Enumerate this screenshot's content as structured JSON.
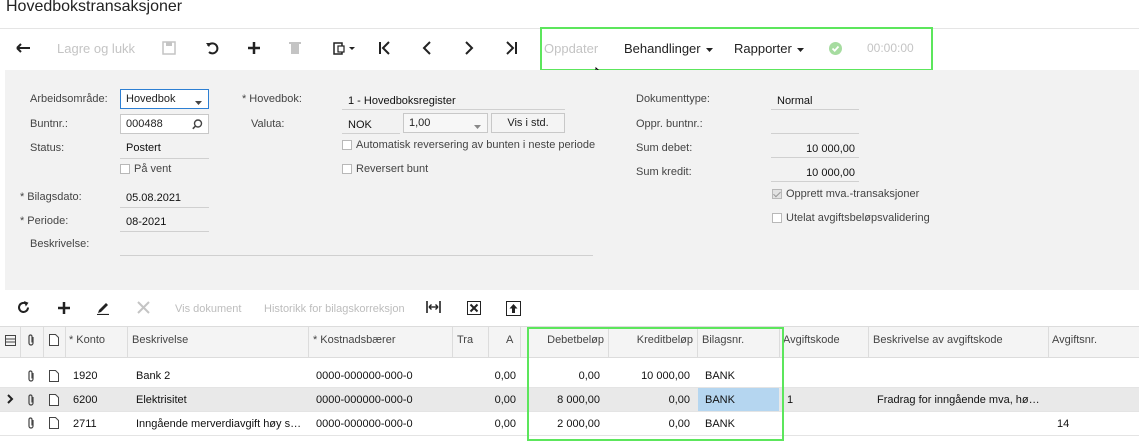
{
  "page": {
    "title": "Hovedbokstransaksjoner"
  },
  "toolbar": {
    "save_close": "Lagre og lukk",
    "update": "Oppdater",
    "actions": "Behandlinger",
    "reports": "Rapporter",
    "timer": "00:00:00",
    "icons": [
      "back-arrow-icon",
      "save-icon",
      "undo-icon",
      "add-icon",
      "delete-icon",
      "copy-paste-icon",
      "first-record-icon",
      "previous-record-icon",
      "next-record-icon",
      "last-record-icon",
      "checkmark-icon",
      "chevron-down-icon"
    ]
  },
  "form": {
    "arbeidsomrade_label": "Arbeidsområde:",
    "arbeidsomrade_value": "Hovedbok",
    "buntnr_label": "Buntnr.:",
    "buntnr_value": "000488",
    "status_label": "Status:",
    "status_value": "Postert",
    "pavent_label": "På vent",
    "bilagsdato_label": "Bilagsdato:",
    "bilagsdato_value": "05.08.2021",
    "periode_label": "Periode:",
    "periode_value": "08-2021",
    "beskrivelse_label": "Beskrivelse:",
    "hovedbok_label": "Hovedbok:",
    "hovedbok_value": "1 - Hovedboksregister",
    "valuta_label": "Valuta:",
    "valuta_value": "NOK",
    "valuta_rate": "1,00",
    "vis_std_label": "Vis i std.",
    "auto_rev_label": "Automatisk reversering av bunten i neste periode",
    "reversert_label": "Reversert bunt",
    "dokumenttype_label": "Dokumenttype:",
    "dokumenttype_value": "Normal",
    "oppr_buntnr_label": "Oppr. buntnr.:",
    "sum_debet_label": "Sum debet:",
    "sum_debet_value": "10 000,00",
    "sum_kredit_label": "Sum kredit:",
    "sum_kredit_value": "10 000,00",
    "opprett_mva_label": "Opprett mva.-transaksjoner",
    "utelat_label": "Utelat avgiftsbeløpsvalidering"
  },
  "grid_toolbar": {
    "vis_dokument": "Vis dokument",
    "historikk": "Historikk for bilagskorreksjon",
    "icons": [
      "refresh-icon",
      "add-row-icon",
      "edit-icon",
      "delete-row-icon",
      "fit-columns-icon",
      "excel-export-icon",
      "upload-icon"
    ]
  },
  "grid": {
    "columns": {
      "konto": "Konto",
      "beskrivelse": "Beskrivelse",
      "kostnadsbaerer": "Kostnadsbærer",
      "tra": "Tra",
      "a": "A",
      "debet": "Debetbeløp",
      "kredit": "Kreditbeløp",
      "bilagsnr": "Bilagsnr.",
      "avgiftskode": "Avgiftskode",
      "besk_avgift": "Beskrivelse av avgiftskode",
      "avgiftsnr": "Avgiftsnr."
    },
    "rows": [
      {
        "konto": "1920",
        "beskrivelse": "Bank 2",
        "kostnadsbaerer": "0000-000000-000-0",
        "a": "0,00",
        "debet": "0,00",
        "kredit": "10 000,00",
        "bilagsnr": "BANK",
        "avgiftskode": "",
        "besk_avgift": "",
        "avgiftsnr": ""
      },
      {
        "konto": "6200",
        "beskrivelse": "Elektrisitet",
        "kostnadsbaerer": "0000-000000-000-0",
        "a": "0,00",
        "debet": "8 000,00",
        "kredit": "0,00",
        "bilagsnr": "BANK",
        "avgiftskode": "1",
        "besk_avgift": "Fradrag for inngående mva, hø…",
        "avgiftsnr": ""
      },
      {
        "konto": "2711",
        "beskrivelse": "Inngående merverdiavgift høy s…",
        "kostnadsbaerer": "0000-000000-000-0",
        "a": "0,00",
        "debet": "2 000,00",
        "kredit": "0,00",
        "bilagsnr": "BANK",
        "avgiftskode": "",
        "besk_avgift": "",
        "avgiftsnr": "14"
      }
    ]
  },
  "colors": {
    "highlight": "#5ce65c",
    "selected_cell": "#b5d6f0",
    "focus_border": "#2d7fd3",
    "success": "#7ccf72"
  }
}
